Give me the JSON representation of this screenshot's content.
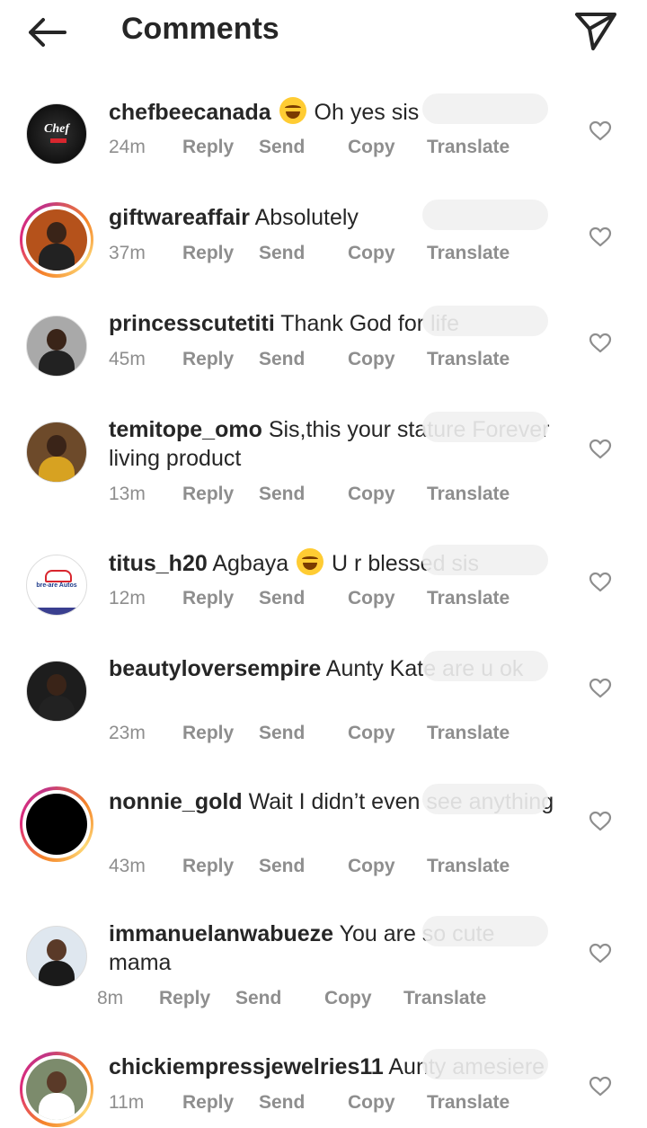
{
  "header": {
    "title": "Comments"
  },
  "actions": {
    "reply": "Reply",
    "send": "Send",
    "copy": "Copy",
    "translate": "Translate"
  },
  "comments": [
    {
      "username": "chefbeecanada",
      "text": "Oh yes sis",
      "emoji_before": true,
      "time": "24m",
      "avatar_color": "#1b1b1b",
      "ring": false,
      "avatar_text": "Chef"
    },
    {
      "username": "giftwareaffair",
      "text": "Absolutely",
      "time": "37m",
      "avatar_color": "#b5521b",
      "ring": true
    },
    {
      "username": "princesscutetiti",
      "text": "Thank God for life",
      "time": "45m",
      "avatar_color": "#a9a9a9",
      "ring": false
    },
    {
      "username": "temitope_omo",
      "text": "Sis,this your stature Forever living product",
      "time": "13m",
      "avatar_color": "#6d4a2a",
      "ring": false
    },
    {
      "username": "titus_h20",
      "text": "Agbaya",
      "text_after": "U r blessed sis",
      "emoji_between": true,
      "time": "12m",
      "avatar_color": "#ffffff",
      "ring": false,
      "avatar_text": "bre-are Autos"
    },
    {
      "username": "beautyloversempire",
      "text": "Aunty Kate are u ok",
      "time": "23m",
      "avatar_color": "#1d1d1d",
      "ring": false
    },
    {
      "username": "nonnie_gold",
      "text": "Wait I didn’t even see anything",
      "time": "43m",
      "avatar_color": "#000000",
      "ring": true
    },
    {
      "username": "immanuelanwabueze",
      "text": "You are so cute mama",
      "time": "8m",
      "avatar_color": "#dfe7ef",
      "ring": false
    },
    {
      "username": "chickiempressjewelries11",
      "text": "Aunty amesiere",
      "time": "11m",
      "avatar_color": "#7c8b6c",
      "ring": true
    }
  ],
  "colors": {
    "text": "#262626",
    "meta": "#8e8e8e",
    "ring_gradient": [
      "#f58529",
      "#dd2a7b",
      "#feda77"
    ]
  },
  "icons": {
    "back": "arrow-left-icon",
    "send": "paper-plane-icon",
    "like": "heart-outline-icon"
  }
}
